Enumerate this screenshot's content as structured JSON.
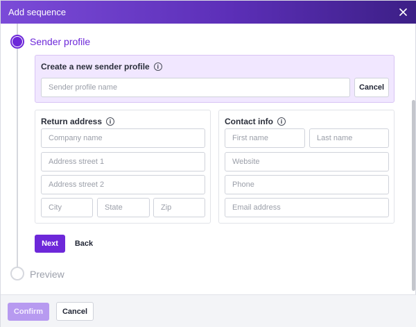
{
  "header": {
    "title": "Add sequence"
  },
  "steps": {
    "sender_profile": {
      "title": "Sender profile"
    },
    "preview": {
      "title": "Preview"
    }
  },
  "create_profile": {
    "label": "Create a new sender profile",
    "name_placeholder": "Sender profile name",
    "cancel_label": "Cancel"
  },
  "return_address": {
    "label": "Return address",
    "company_placeholder": "Company name",
    "street1_placeholder": "Address street 1",
    "street2_placeholder": "Address street 2",
    "city_placeholder": "City",
    "state_placeholder": "State",
    "zip_placeholder": "Zip"
  },
  "contact_info": {
    "label": "Contact info",
    "first_name_placeholder": "First name",
    "last_name_placeholder": "Last name",
    "website_placeholder": "Website",
    "phone_placeholder": "Phone",
    "email_placeholder": "Email address"
  },
  "actions": {
    "next_label": "Next",
    "back_label": "Back"
  },
  "footer": {
    "confirm_label": "Confirm",
    "cancel_label": "Cancel"
  },
  "colors": {
    "accent": "#6d28d9",
    "accent_light": "#f1e7ff",
    "header_gradient_end": "#3c1f86"
  },
  "icons": {
    "close": "close-icon",
    "info": "info-icon"
  }
}
